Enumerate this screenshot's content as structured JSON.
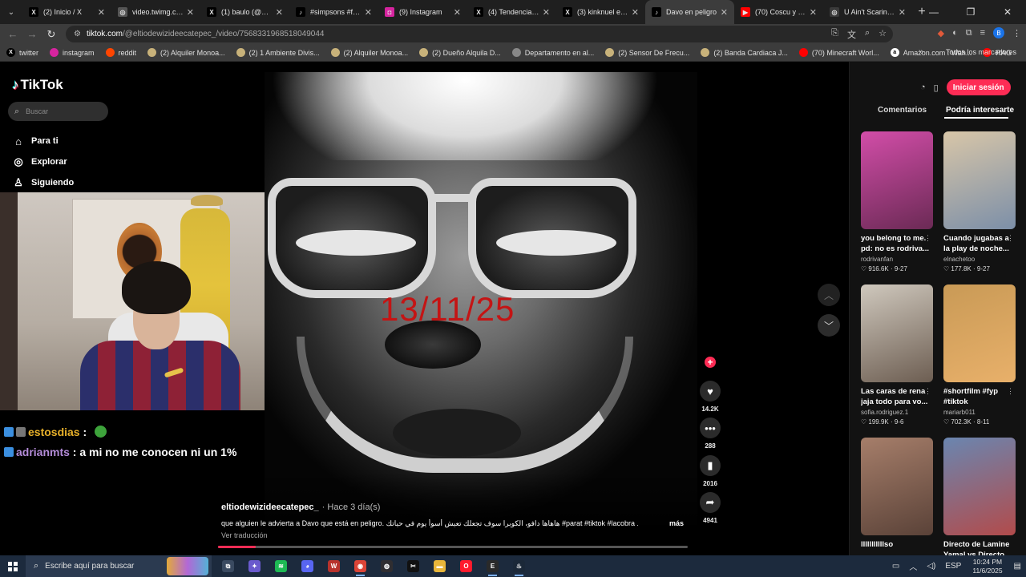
{
  "browser": {
    "tabs": [
      {
        "title": "(2) Inicio / X",
        "icon": "x-logo-icon",
        "color": "#000000",
        "glyph": "X"
      },
      {
        "title": "video.twimg.com",
        "icon": "globe-icon",
        "color": "#555555",
        "glyph": "◎"
      },
      {
        "title": "(1) baulo (@bautista",
        "icon": "x-logo-icon",
        "color": "#000000",
        "glyph": "X"
      },
      {
        "title": "#simpsons #fortnite",
        "icon": "tiktok-icon",
        "color": "#000000",
        "glyph": "♪"
      },
      {
        "title": "(9) Instagram",
        "icon": "instagram-icon",
        "color": "#d6249f",
        "glyph": "◘"
      },
      {
        "title": "(4) Tendencias en",
        "icon": "x-logo-icon",
        "color": "#000000",
        "glyph": "X"
      },
      {
        "title": "(3) kinknuel en X",
        "icon": "x-logo-icon",
        "color": "#000000",
        "glyph": "X"
      },
      {
        "title": "Davo en peligro",
        "icon": "tiktok-icon",
        "color": "#000000",
        "glyph": "♪",
        "active": true
      },
      {
        "title": "(70) Coscu y la sec",
        "icon": "youtube-icon",
        "color": "#ff0000",
        "glyph": "▶"
      },
      {
        "title": "U Ain't Scaring N",
        "icon": "globe-icon",
        "color": "#3a3a3a",
        "glyph": "◎"
      }
    ],
    "url_host": "tiktok.com",
    "url_path": "/@eltiodewizideecatepec_/video/7568331968518049044",
    "bookmarks": [
      {
        "label": "twitter",
        "icon": "x-logo-icon",
        "color": "#000000",
        "glyph": "X"
      },
      {
        "label": "instagram",
        "icon": "instagram-icon",
        "color": "#d6249f",
        "glyph": ""
      },
      {
        "label": "reddit",
        "icon": "reddit-icon",
        "color": "#ff4500",
        "glyph": ""
      },
      {
        "label": "(2) Alquiler Monoa...",
        "icon": "marketplace-icon",
        "color": "#c8b27a",
        "glyph": ""
      },
      {
        "label": "(2) 1 Ambiente Divis...",
        "icon": "marketplace-icon",
        "color": "#c8b27a",
        "glyph": ""
      },
      {
        "label": "(2) Alquiler Monoa...",
        "icon": "marketplace-icon",
        "color": "#c8b27a",
        "glyph": ""
      },
      {
        "label": "(2) Dueño Alquila D...",
        "icon": "marketplace-icon",
        "color": "#c8b27a",
        "glyph": ""
      },
      {
        "label": "Departamento en al...",
        "icon": "image-icon",
        "color": "#888888",
        "glyph": ""
      },
      {
        "label": "(2) Sensor De Frecu...",
        "icon": "marketplace-icon",
        "color": "#c8b27a",
        "glyph": ""
      },
      {
        "label": "(2) Banda Cardiaca J...",
        "icon": "marketplace-icon",
        "color": "#c8b27a",
        "glyph": ""
      },
      {
        "label": "(70) Minecraft Worl...",
        "icon": "youtube-icon",
        "color": "#ff0000",
        "glyph": ""
      },
      {
        "label": "Amazon.com : Wah...",
        "icon": "amazon-icon",
        "color": "#ffffff",
        "glyph": "a"
      },
      {
        "label": "RAG",
        "icon": "youtube-icon",
        "color": "#ff0000",
        "glyph": ""
      }
    ],
    "all_bookmarks": "Todos los marcadores"
  },
  "tiktok": {
    "logo": "TikTok",
    "search_placeholder": "Buscar",
    "nav": [
      {
        "label": "Para ti",
        "icon": "home-icon",
        "glyph": "⌂"
      },
      {
        "label": "Explorar",
        "icon": "compass-icon",
        "glyph": "◎"
      },
      {
        "label": "Siguiendo",
        "icon": "following-icon",
        "glyph": "♙"
      }
    ],
    "video": {
      "overlay_text": "13/11/25",
      "author": "eltiodewizideecatepec_",
      "posted": "· Hace 3 día(s)",
      "caption": "que alguien le advierta a Davo que está en peligro. هاهاها دافو، الكوبرا سوف تجعلك تعيش أسوأ يوم في حياتك #parat #tiktok #lacobra ...",
      "more": "más",
      "translate": "Ver traducción",
      "progress": 0.08
    },
    "actions": [
      {
        "name": "like",
        "icon": "heart-icon",
        "glyph": "♥",
        "count": "14.2K"
      },
      {
        "name": "comment",
        "icon": "comment-icon",
        "glyph": "•••",
        "count": "288"
      },
      {
        "name": "save",
        "icon": "bookmark-icon",
        "glyph": "▮",
        "count": "2016"
      },
      {
        "name": "share",
        "icon": "share-icon",
        "glyph": "➦",
        "count": "4941"
      }
    ],
    "panel": {
      "login": "Iniciar sesión",
      "tabs": [
        "Comentarios",
        "Podría interesarte"
      ],
      "cards": [
        {
          "title": "you belong to me. pd: no es rodriva...",
          "user": "rodrivanfan",
          "likes": "916.6K",
          "date": "9-27",
          "colors": [
            "#d24da8",
            "#6b2a55"
          ]
        },
        {
          "title": "Cuando jugabas a la play de noche...",
          "user": "elnachetoo",
          "likes": "177.8K",
          "date": "9-27",
          "colors": [
            "#d8c6a8",
            "#7c8fa8"
          ]
        },
        {
          "title": "Las caras de rena jaja todo para vo...",
          "user": "sofia.rodriguez.1",
          "likes": "199.9K",
          "date": "9-6",
          "colors": [
            "#cfc8bd",
            "#6d5e52"
          ]
        },
        {
          "title": "#shortfilm #fyp #tiktok",
          "user": "mariarb011",
          "likes": "702.3K",
          "date": "8-11",
          "colors": [
            "#c99a56",
            "#e8b06a"
          ]
        },
        {
          "title": "lllllllllllso",
          "user": "",
          "likes": "",
          "date": "",
          "colors": [
            "#a67e6a",
            "#5a4238"
          ]
        },
        {
          "title": "Directo de Lamine Yamal vs Directo...",
          "user": "",
          "likes": "",
          "date": "",
          "colors": [
            "#6a86b0",
            "#b24b4b"
          ]
        }
      ]
    }
  },
  "stream_chat": [
    {
      "user": "estosdias",
      "message": "",
      "user_color": "#e8b12a",
      "emote": true
    },
    {
      "user": "adrianmts",
      "message": "a mi no me conocen ni un 1%",
      "user_color": "#b48cd9",
      "emote": false
    }
  ],
  "taskbar": {
    "search_placeholder": "Escribe aquí para buscar",
    "apps": [
      {
        "name": "task-view",
        "icon": "task-view-icon",
        "color": "#3a4a60",
        "glyph": "⧉"
      },
      {
        "name": "copilot",
        "icon": "copilot-icon",
        "color": "#6a5acd",
        "glyph": "✦"
      },
      {
        "name": "spotify",
        "icon": "spotify-icon",
        "color": "#1db954",
        "glyph": "≋"
      },
      {
        "name": "discord",
        "icon": "discord-icon",
        "color": "#5865f2",
        "glyph": "◕"
      },
      {
        "name": "tftd",
        "icon": "game-icon",
        "color": "#b8322c",
        "glyph": "W"
      },
      {
        "name": "chrome",
        "icon": "chrome-icon",
        "color": "#db4437",
        "glyph": "◉",
        "open": true
      },
      {
        "name": "obs",
        "icon": "obs-icon",
        "color": "#302e31",
        "glyph": "◍"
      },
      {
        "name": "capcut",
        "icon": "capcut-icon",
        "color": "#111111",
        "glyph": "✂"
      },
      {
        "name": "explorer",
        "icon": "folder-icon",
        "color": "#e8b63a",
        "glyph": "▬"
      },
      {
        "name": "opera",
        "icon": "opera-icon",
        "color": "#ff1b2d",
        "glyph": "O"
      },
      {
        "name": "epic",
        "icon": "epic-games-icon",
        "color": "#2a2a2a",
        "glyph": "E",
        "open": true
      },
      {
        "name": "steam",
        "icon": "steam-icon",
        "color": "#1b2838",
        "glyph": "♨",
        "open": true
      }
    ],
    "lang": "ESP",
    "time": "10:24 PM",
    "date": "11/6/2025"
  }
}
